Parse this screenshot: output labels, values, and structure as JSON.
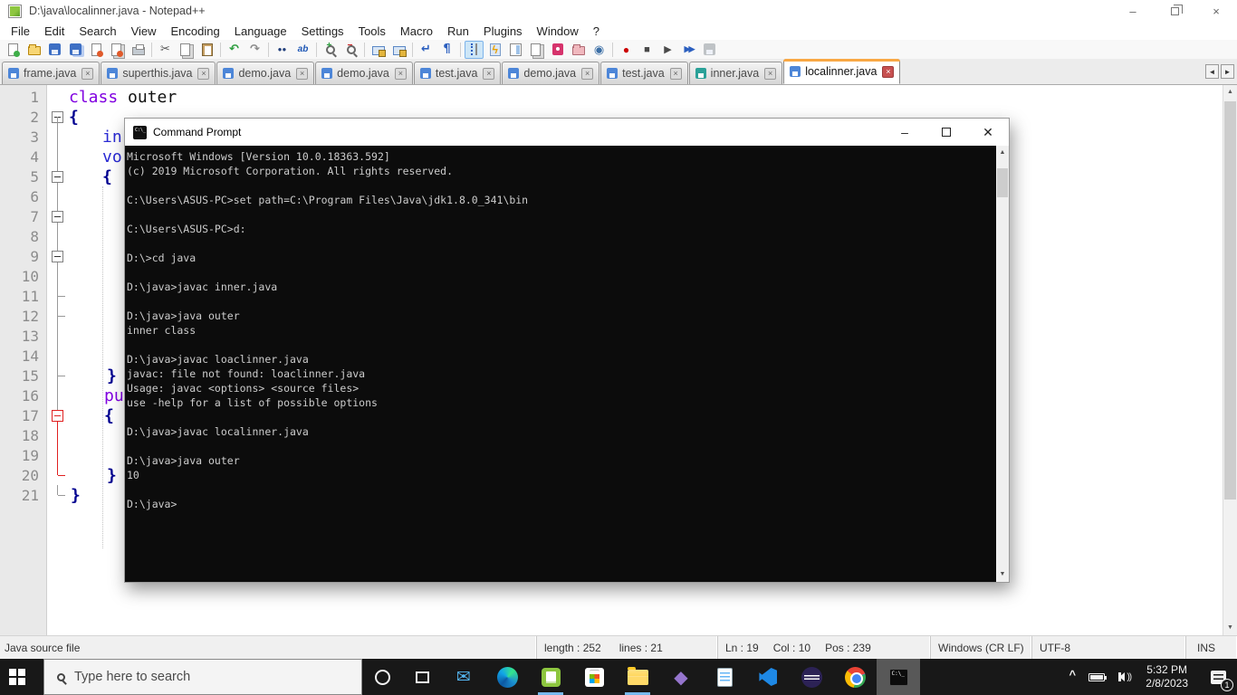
{
  "colors": {
    "active_tab_accent": "#f9a845",
    "current_line_highlight": "#e8e8fb",
    "terminal_background": "#0c0c0c",
    "terminal_foreground": "#cccccc",
    "keyword_purple": "#8000e0",
    "type_blue": "#2a2ad4",
    "brace_navy": "#000090",
    "fold_active_red": "#e02020",
    "taskbar_background": "#181818",
    "running_indicator": "#76b9ed"
  },
  "window": {
    "title": "D:\\java\\localinner.java - Notepad++",
    "controls": {
      "minimize": "–",
      "close": "×"
    }
  },
  "menu": {
    "items": [
      "File",
      "Edit",
      "Search",
      "View",
      "Encoding",
      "Language",
      "Settings",
      "Tools",
      "Macro",
      "Run",
      "Plugins",
      "Window",
      "?"
    ]
  },
  "toolbar": {
    "icons": [
      {
        "name": "new-file-icon",
        "cls": "i-new"
      },
      {
        "name": "open-file-icon",
        "cls": "i-open"
      },
      {
        "name": "save-icon",
        "cls": "i-save"
      },
      {
        "name": "save-all-icon",
        "cls": "i-saveall"
      },
      {
        "name": "close-file-icon",
        "cls": "i-close"
      },
      {
        "name": "close-all-icon",
        "cls": "i-closeall"
      },
      {
        "name": "print-icon",
        "cls": "i-print",
        "sep": true
      },
      {
        "name": "cut-icon",
        "cls": "i-cut"
      },
      {
        "name": "copy-icon",
        "cls": "i-copy"
      },
      {
        "name": "paste-icon",
        "cls": "i-paste",
        "sep": true
      },
      {
        "name": "undo-icon",
        "cls": "i-undo"
      },
      {
        "name": "redo-icon",
        "cls": "i-redo",
        "sep": true
      },
      {
        "name": "find-icon",
        "cls": "i-find"
      },
      {
        "name": "replace-icon",
        "cls": "i-replace",
        "sep": true
      },
      {
        "name": "zoom-in-icon",
        "cls": "i-zoomin"
      },
      {
        "name": "zoom-out-icon",
        "cls": "i-zoomout",
        "sep": true
      },
      {
        "name": "sync-vertical-scrolling-icon",
        "cls": "i-sync"
      },
      {
        "name": "sync-horizontal-scrolling-icon",
        "cls": "i-sync",
        "sep": true
      },
      {
        "name": "word-wrap-icon",
        "cls": "i-wrap"
      },
      {
        "name": "show-all-characters-icon",
        "cls": "i-pilcrow",
        "sep": true
      },
      {
        "name": "indent-guide-icon",
        "cls": "i-indent",
        "active": true
      },
      {
        "name": "function-list-icon",
        "cls": "i-funclist"
      },
      {
        "name": "document-map-icon",
        "cls": "i-docmap"
      },
      {
        "name": "document-list-icon",
        "cls": "i-doclist"
      },
      {
        "name": "define-language-icon",
        "cls": "i-deflang"
      },
      {
        "name": "folder-as-workspace-icon",
        "cls": "i-folderws"
      },
      {
        "name": "view-eye-icon",
        "cls": "i-eye",
        "sep": true
      },
      {
        "name": "macro-record-icon",
        "cls": "i-record"
      },
      {
        "name": "macro-stop-icon",
        "cls": "i-stop"
      },
      {
        "name": "macro-play-icon",
        "cls": "i-play"
      },
      {
        "name": "macro-run-multiple-icon",
        "cls": "i-playmulti"
      },
      {
        "name": "macro-save-icon",
        "cls": "i-macrosave"
      }
    ]
  },
  "tabs": [
    {
      "label": "frame.java",
      "disk": "blue"
    },
    {
      "label": "superthis.java",
      "disk": "blue"
    },
    {
      "label": "demo.java",
      "disk": "blue"
    },
    {
      "label": "demo.java",
      "disk": "blue"
    },
    {
      "label": "test.java",
      "disk": "blue"
    },
    {
      "label": "demo.java",
      "disk": "blue"
    },
    {
      "label": "test.java",
      "disk": "blue"
    },
    {
      "label": "inner.java",
      "disk": "teal"
    },
    {
      "label": "localinner.java",
      "disk": "blue",
      "active": true
    }
  ],
  "editor": {
    "lines": [
      {
        "num": "1",
        "indent": 0,
        "fold": "",
        "segs": [
          {
            "t": "class",
            "c": "kw"
          },
          {
            "t": " outer",
            "c": "pl"
          }
        ]
      },
      {
        "num": "2",
        "indent": 0,
        "fold": "boxfirst",
        "segs": [
          {
            "t": "{",
            "c": "br"
          }
        ]
      },
      {
        "num": "3",
        "indent": 37,
        "fold": "v",
        "segs": [
          {
            "t": "in",
            "c": "ty"
          }
        ]
      },
      {
        "num": "4",
        "indent": 37,
        "fold": "v",
        "segs": [
          {
            "t": "vo",
            "c": "ty"
          }
        ]
      },
      {
        "num": "5",
        "indent": 37,
        "fold": "boxmid",
        "segs": [
          {
            "t": "{",
            "c": "br"
          }
        ]
      },
      {
        "num": "6",
        "indent": 0,
        "fold": "v",
        "segs": []
      },
      {
        "num": "7",
        "indent": 0,
        "fold": "boxmid",
        "segs": []
      },
      {
        "num": "8",
        "indent": 0,
        "fold": "v",
        "segs": []
      },
      {
        "num": "9",
        "indent": 0,
        "fold": "boxmid",
        "segs": []
      },
      {
        "num": "10",
        "indent": 0,
        "fold": "v",
        "segs": []
      },
      {
        "num": "11",
        "indent": 0,
        "fold": "vtick",
        "segs": []
      },
      {
        "num": "12",
        "indent": 0,
        "fold": "vtick",
        "segs": []
      },
      {
        "num": "13",
        "indent": 0,
        "fold": "v",
        "segs": []
      },
      {
        "num": "14",
        "indent": 0,
        "fold": "v",
        "segs": []
      },
      {
        "num": "15",
        "indent": 42,
        "fold": "vtick",
        "segs": [
          {
            "t": "}",
            "c": "br"
          }
        ]
      },
      {
        "num": "16",
        "indent": 39,
        "fold": "v",
        "segs": [
          {
            "t": "pu",
            "c": "kw"
          }
        ]
      },
      {
        "num": "17",
        "indent": 39,
        "fold": "redbox",
        "segs": [
          {
            "t": "{",
            "c": "br"
          }
        ]
      },
      {
        "num": "18",
        "indent": 0,
        "fold": "redv",
        "segs": []
      },
      {
        "num": "19",
        "indent": 0,
        "fold": "redv",
        "current": true,
        "segs": []
      },
      {
        "num": "20",
        "indent": 42,
        "fold": "redend",
        "segs": [
          {
            "t": "}",
            "c": "br"
          }
        ]
      },
      {
        "num": "21",
        "indent": 2,
        "fold": "end",
        "segs": [
          {
            "t": "}",
            "c": "br"
          }
        ]
      }
    ]
  },
  "cmd": {
    "title": "Command Prompt",
    "lines": [
      "Microsoft Windows [Version 10.0.18363.592]",
      "(c) 2019 Microsoft Corporation. All rights reserved.",
      "",
      "C:\\Users\\ASUS-PC>set path=C:\\Program Files\\Java\\jdk1.8.0_341\\bin",
      "",
      "C:\\Users\\ASUS-PC>d:",
      "",
      "D:\\>cd java",
      "",
      "D:\\java>javac inner.java",
      "",
      "D:\\java>java outer",
      "inner class",
      "",
      "D:\\java>javac loaclinner.java",
      "javac: file not found: loaclinner.java",
      "Usage: javac <options> <source files>",
      "use -help for a list of possible options",
      "",
      "D:\\java>javac localinner.java",
      "",
      "D:\\java>java outer",
      "10",
      "",
      "D:\\java>"
    ]
  },
  "status": {
    "doc_type": "Java source file",
    "length": "length : 252",
    "lines": "lines : 21",
    "ln": "Ln : 19",
    "col": "Col : 10",
    "pos": "Pos : 239",
    "eol": "Windows (CR LF)",
    "encoding": "UTF-8",
    "mode": "INS"
  },
  "taskbar": {
    "search_text": "Type here to search",
    "apps": [
      {
        "name": "taskbar-mail",
        "cls": "app-mail",
        "glyph": "✉"
      },
      {
        "name": "taskbar-edge",
        "cls": "app-edge"
      },
      {
        "name": "taskbar-notepad-plus-plus",
        "cls": "app-npp",
        "running": true
      },
      {
        "name": "taskbar-microsoft-store",
        "cls": "app-store"
      },
      {
        "name": "taskbar-file-explorer",
        "cls": "app-explorer",
        "running": true
      },
      {
        "name": "taskbar-visual-studio",
        "cls": "app-vs",
        "glyph": "◆"
      },
      {
        "name": "taskbar-notepad",
        "cls": "app-notepad"
      },
      {
        "name": "taskbar-vscode",
        "cls": "app-vscode"
      },
      {
        "name": "taskbar-eclipse",
        "cls": "app-eclipse"
      },
      {
        "name": "taskbar-chrome",
        "cls": "app-chrome"
      },
      {
        "name": "taskbar-command-prompt",
        "cls": "app-cmd",
        "active": true
      }
    ],
    "tray": {
      "time": "5:32 PM",
      "date": "2/8/2023",
      "badge": "1"
    }
  }
}
